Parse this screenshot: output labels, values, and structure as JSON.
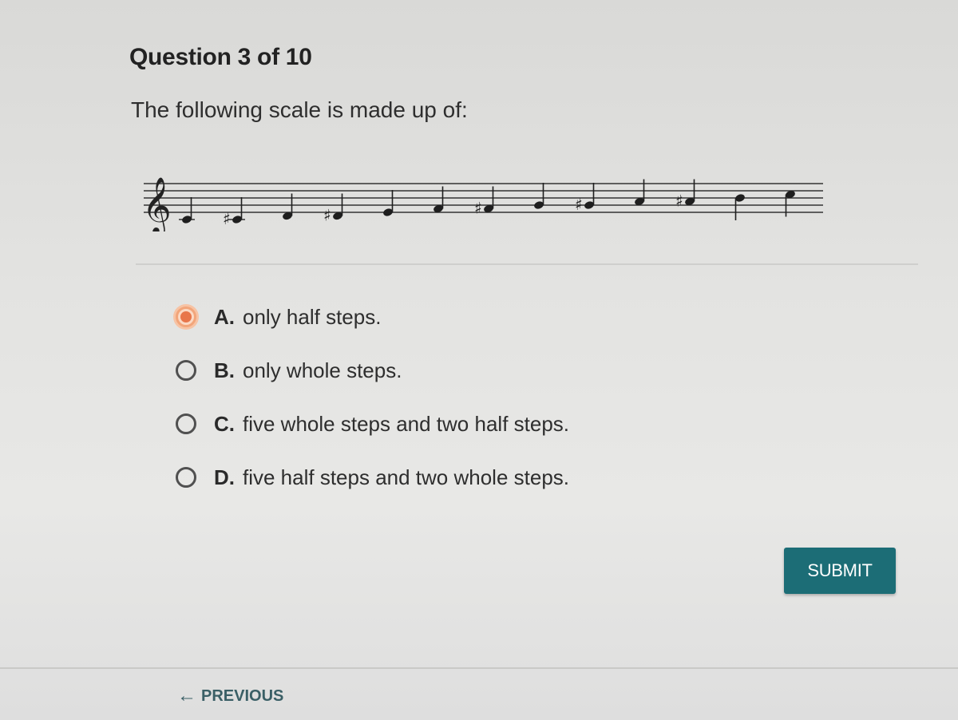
{
  "question": {
    "header": "Question 3 of 10",
    "prompt": "The following scale is made up of:"
  },
  "staff": {
    "clef": "treble",
    "notes": [
      {
        "step": "C",
        "accidental": ""
      },
      {
        "step": "C",
        "accidental": "#"
      },
      {
        "step": "D",
        "accidental": ""
      },
      {
        "step": "D",
        "accidental": "#"
      },
      {
        "step": "E",
        "accidental": ""
      },
      {
        "step": "F",
        "accidental": ""
      },
      {
        "step": "F",
        "accidental": "#"
      },
      {
        "step": "G",
        "accidental": ""
      },
      {
        "step": "G",
        "accidental": "#"
      },
      {
        "step": "A",
        "accidental": ""
      },
      {
        "step": "A",
        "accidental": "#"
      },
      {
        "step": "B",
        "accidental": ""
      },
      {
        "step": "C",
        "accidental": ""
      }
    ]
  },
  "options": [
    {
      "letter": "A.",
      "text": "only half steps.",
      "selected": true
    },
    {
      "letter": "B.",
      "text": "only whole steps.",
      "selected": false
    },
    {
      "letter": "C.",
      "text": "five whole steps and two half steps.",
      "selected": false
    },
    {
      "letter": "D.",
      "text": "five half steps and two whole steps.",
      "selected": false
    }
  ],
  "buttons": {
    "submit_label": "SUBMIT",
    "previous_label": "PREVIOUS"
  },
  "colors": {
    "accent": "#1c6d76",
    "selected_radio": "#e8764a"
  }
}
